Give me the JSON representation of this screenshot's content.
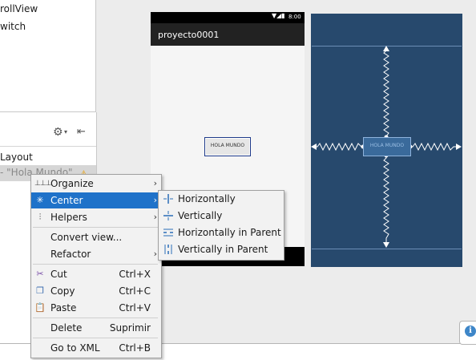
{
  "palette": {
    "items": [
      "rollView",
      "witch"
    ]
  },
  "component_tree": {
    "layout_label": "Layout",
    "selected_label": "- \"Hola Mundo\""
  },
  "preview": {
    "status_time": "8:00",
    "app_title": "proyecto0001",
    "button_text": "HOLA MUNDO"
  },
  "blueprint": {
    "button_text": "HOLA MUNDO"
  },
  "context_menu": {
    "items": [
      {
        "label": "Organize",
        "shortcut": "",
        "icon": "organize-icon",
        "submenu": true
      },
      {
        "label": "Center",
        "shortcut": "",
        "icon": "center-icon",
        "submenu": true
      },
      {
        "label": "Helpers",
        "shortcut": "",
        "icon": "helpers-icon",
        "submenu": true
      },
      {
        "label": "Convert view...",
        "shortcut": "",
        "icon": "",
        "submenu": false
      },
      {
        "label": "Refactor",
        "shortcut": "",
        "icon": "",
        "submenu": true
      },
      {
        "label": "Cut",
        "shortcut": "Ctrl+X",
        "icon": "cut-icon",
        "submenu": false
      },
      {
        "label": "Copy",
        "shortcut": "Ctrl+C",
        "icon": "copy-icon",
        "submenu": false
      },
      {
        "label": "Paste",
        "shortcut": "Ctrl+V",
        "icon": "paste-icon",
        "submenu": false
      },
      {
        "label": "Delete",
        "shortcut": "Suprimir",
        "icon": "",
        "submenu": false
      },
      {
        "label": "Go to XML",
        "shortcut": "Ctrl+B",
        "icon": "",
        "submenu": false
      }
    ],
    "highlighted": "Center"
  },
  "center_submenu": {
    "items": [
      {
        "label": "Horizontally",
        "icon": "center-horizontally-icon"
      },
      {
        "label": "Vertically",
        "icon": "center-vertically-icon"
      },
      {
        "label": "Horizontally in Parent",
        "icon": "center-horizontally-parent-icon"
      },
      {
        "label": "Vertically in Parent",
        "icon": "center-vertically-parent-icon"
      }
    ]
  },
  "colors": {
    "menu_highlight": "#1f72c9",
    "blueprint_bg": "#27496d",
    "accent_blue": "#3e86c8"
  }
}
